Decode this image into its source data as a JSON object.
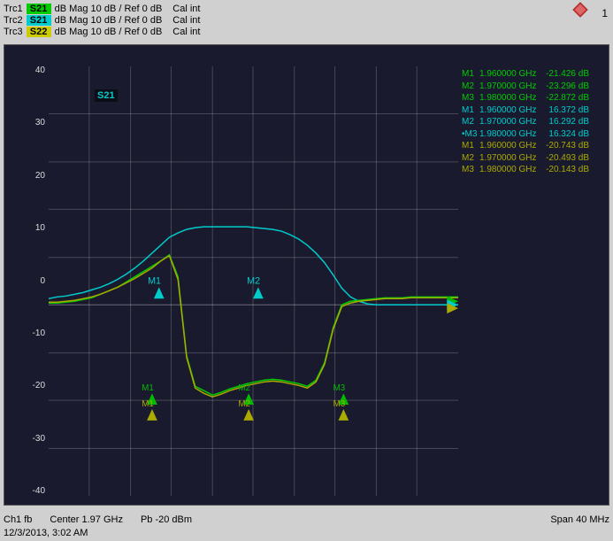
{
  "traces": [
    {
      "id": "Trc1",
      "badge": "S21",
      "badge_class": "badge-s21",
      "color": "#00cc00",
      "params": "dB Mag  10 dB /  Ref 0 dB",
      "cal": "Cal int"
    },
    {
      "id": "Trc2",
      "badge": "S21",
      "badge_class": "badge-s21b",
      "color": "#00cccc",
      "params": "dB Mag  10 dB /  Ref 0 dB",
      "cal": "Cal int"
    },
    {
      "id": "Trc3",
      "badge": "S22",
      "badge_class": "badge-s22",
      "color": "#cccc00",
      "params": "dB Mag  10 dB /  Ref 0 dB",
      "cal": "Cal int"
    }
  ],
  "markers": {
    "group1_color": "#00cc00",
    "group2_color": "#00cccc",
    "group3_color": "#cccc00",
    "rows": [
      {
        "id": "M1",
        "freq": "1.960000",
        "unit": "GHz",
        "val": "-21.426 dB",
        "color": "#00cc00"
      },
      {
        "id": "M2",
        "freq": "1.970000",
        "unit": "GHz",
        "val": "-23.296 dB",
        "color": "#00cc00"
      },
      {
        "id": "M3",
        "freq": "1.980000",
        "unit": "GHz",
        "val": "-22.872 dB",
        "color": "#00cc00"
      },
      {
        "id": "M1",
        "freq": "1.960000",
        "unit": "GHz",
        "val": "16.372 dB",
        "color": "#00cccc"
      },
      {
        "id": "M2",
        "freq": "1.970000",
        "unit": "GHz",
        "val": "16.292 dB",
        "color": "#00cccc"
      },
      {
        "id": "•M3",
        "freq": "1.980000",
        "unit": "GHz",
        "val": "16.324 dB",
        "color": "#00cccc"
      },
      {
        "id": "M1",
        "freq": "1.960000",
        "unit": "GHz",
        "val": "-20.743 dB",
        "color": "#cccc00"
      },
      {
        "id": "M2",
        "freq": "1.970000",
        "unit": "GHz",
        "val": "-20.493 dB",
        "color": "#cccc00"
      },
      {
        "id": "M3",
        "freq": "1.980000",
        "unit": "GHz",
        "val": "-20.143 dB",
        "color": "#cccc00"
      }
    ]
  },
  "chart": {
    "active_trace": "S21",
    "y_labels": [
      "40",
      "30",
      "20",
      "10",
      "0",
      "-10",
      "-20",
      "-30",
      "-40"
    ],
    "ref_line_db": 0
  },
  "status_bar": {
    "ch": "Ch1  fb",
    "center": "Center  1.97 GHz",
    "pb": "Pb  -20 dBm",
    "span": "Span  40 MHz"
  },
  "timestamp": "12/3/2013, 3:02 AM",
  "page_number": "1",
  "logo": "◆"
}
